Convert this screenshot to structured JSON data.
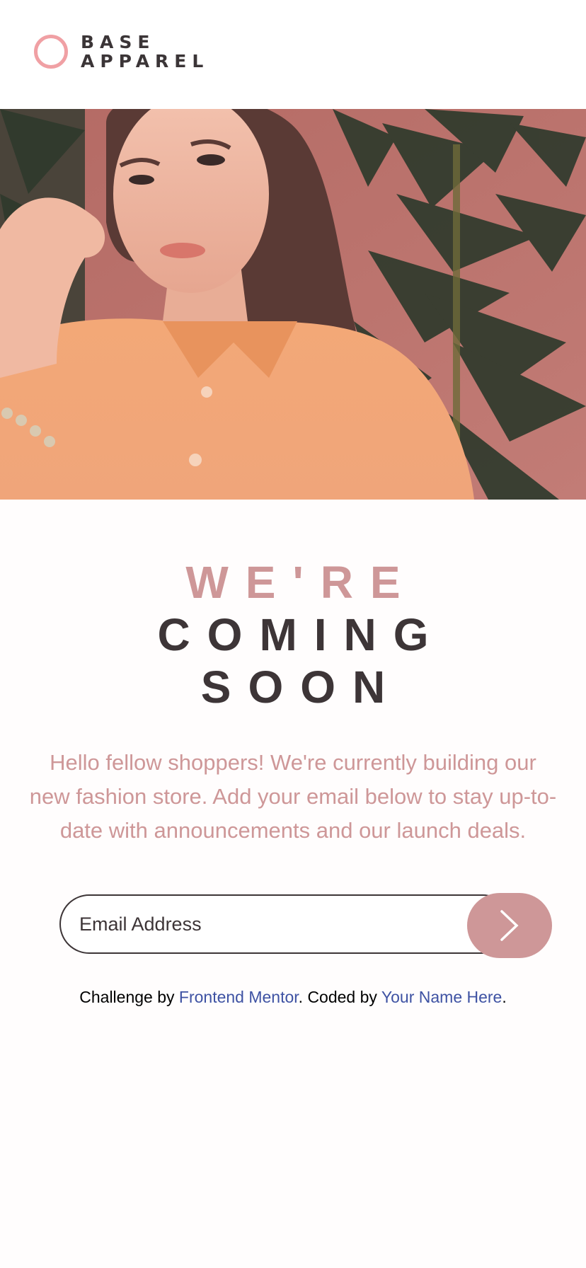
{
  "brand": {
    "name_line1": "BASE",
    "name_line2": "APPAREL"
  },
  "hero": {
    "image_description": "logo-area-hero-photo"
  },
  "headline": {
    "line1": "WE'RE",
    "line2": "COMING",
    "line3": "SOON"
  },
  "description": "Hello fellow shoppers! We're currently building our new fashion store. Add your email below to stay up-to-date with announcements and our launch deals.",
  "form": {
    "email_placeholder": "Email Address",
    "submit_icon": "chevron-right-icon"
  },
  "attribution": {
    "prefix": "Challenge by",
    "link1": "Frontend Mentor",
    "middle": ". Coded by",
    "link2": "Your Name Here",
    "suffix": "."
  },
  "colors": {
    "accent": "#ce9798",
    "dark": "#3d3537",
    "logo_ring": "#f0a0a4",
    "link": "#3e52a3"
  }
}
